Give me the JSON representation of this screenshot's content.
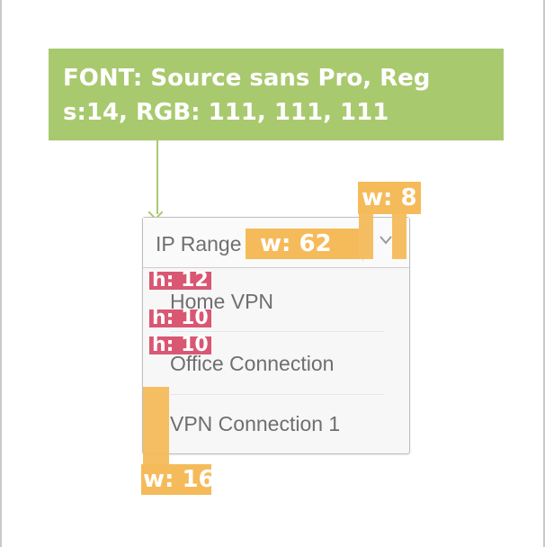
{
  "annotation": {
    "font_spec": "FONT: Source sans Pro, Reg\ns:14, RGB: 111, 111, 111"
  },
  "dropdown": {
    "selected": "IP Range",
    "options": [
      {
        "label": "Home VPN"
      },
      {
        "label": "Office Connection"
      },
      {
        "label": "VPN Connection 1"
      }
    ],
    "text_color": "#6f6f6f",
    "border_color": "#bdbdbd"
  },
  "measurements": {
    "w_text": "w: 62",
    "w_chevron": "w: 8",
    "h_top": "h: 12",
    "h_item": "h: 10",
    "h_item2": "h: 10",
    "w_left": "w: 16"
  },
  "colors": {
    "annotation_green": "#a9c96e",
    "measure_orange": "#f5bb5a",
    "measure_red": "#d95772"
  },
  "icons": {
    "chevron": "chevron-down-icon"
  }
}
